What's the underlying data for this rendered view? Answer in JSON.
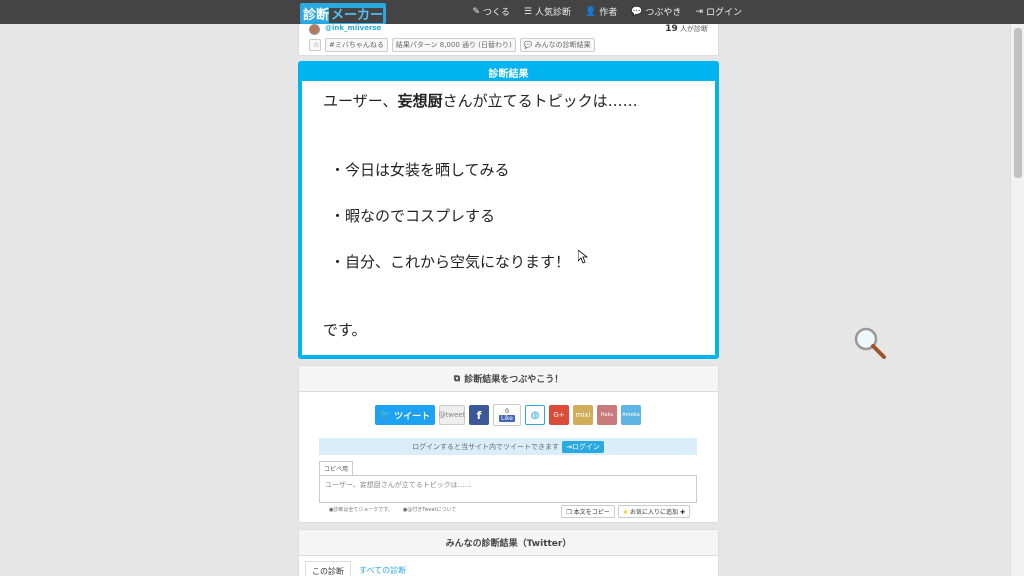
{
  "nav": {
    "logo_a": "診断",
    "logo_b": "メーカー",
    "items": [
      {
        "icon": "edit-icon",
        "glyph": "✎",
        "label": "つくる"
      },
      {
        "icon": "list-icon",
        "glyph": "☰",
        "label": "人気診断"
      },
      {
        "icon": "user-icon",
        "glyph": "👤",
        "label": "作者"
      },
      {
        "icon": "comment-icon",
        "glyph": "💬",
        "label": "つぶやき"
      },
      {
        "icon": "login-icon",
        "glyph": "⇥",
        "label": "ログイン"
      }
    ]
  },
  "author": {
    "handle": "@ink_miiverse",
    "count_number": "19",
    "count_suffix": "人が診断",
    "tags": {
      "star": "☆",
      "hashtag": "#ミバちゃんねる",
      "patterns": "結果パターン 8,000 通り (日替わり)",
      "everyone": "みんなの診断結果"
    }
  },
  "result": {
    "title": "診断結果",
    "line1_pre": "ユーザー、",
    "line1_bold": "妄想厨",
    "line1_post": "さんが立てるトピックは……",
    "item1": "・今日は女装を晒してみる",
    "item2": "・暇なのでコスプレする",
    "item3": "・自分、これから空気になります！",
    "closing": "です。"
  },
  "share": {
    "header": "診断結果をつぶやこう！",
    "tweet_label": "ツイート",
    "atweet_label": "@tweet",
    "fb_label": "f",
    "like_count": "0",
    "like_label": "Like",
    "gplus_label": "G+",
    "mixi_label": "mixi",
    "haku_label": "Haku",
    "ameba_label": "Ameba",
    "login_text": "ログインすると当サイト内でツイートできます",
    "login_button": "ログイン",
    "copy_tab": "コピペ用",
    "copy_text": "ユーザー、妄想厨さんが立てるトピックは……",
    "note1": "●診断は全てジョークです。",
    "note2": "●@付きTweetについて",
    "copy_button": "本文をコピー",
    "fav_button": "お気に入りに追加"
  },
  "everyone": {
    "header": "みんなの診断結果（Twitter）",
    "tab_this": "この診断",
    "tab_all": "すべての診断"
  },
  "colors": {
    "accent": "#00b4f0",
    "nav_bg": "#444444",
    "twitter": "#1da1f2",
    "facebook": "#3b5998"
  }
}
